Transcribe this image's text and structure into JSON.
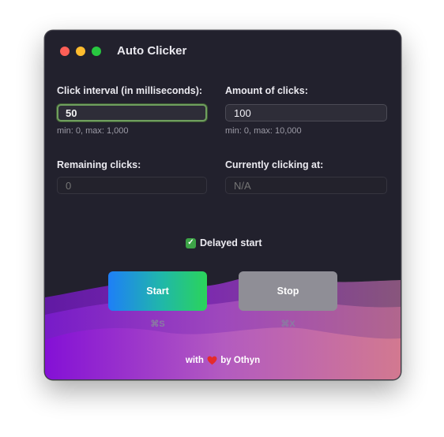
{
  "window": {
    "title": "Auto Clicker"
  },
  "interval": {
    "label": "Click interval (in milliseconds):",
    "value": "50",
    "hint": "min: 0, max: 1,000"
  },
  "amount": {
    "label": "Amount of clicks:",
    "value": "100",
    "hint": "min: 0, max: 10,000"
  },
  "remaining": {
    "label": "Remaining clicks:",
    "placeholder": "0"
  },
  "current": {
    "label": "Currently clicking at:",
    "placeholder": "N/A"
  },
  "delayed_start": {
    "label": "Delayed start",
    "checked": true
  },
  "buttons": {
    "start_label": "Start",
    "start_shortcut": "⌘S",
    "stop_label": "Stop",
    "stop_shortcut": "⌘X"
  },
  "footer": {
    "prefix": "with",
    "suffix": "by Othyn"
  },
  "colors": {
    "window_bg": "#22212d",
    "start_gradient": [
      "#1e7ff7",
      "#2bd45a"
    ],
    "stop_bg": "#8f8e96",
    "wave_purple": "#8a1fd0",
    "wave_pink": "#c87596",
    "checkbox": "#3da447"
  },
  "icons": {
    "checkbox": "checkmark-icon",
    "footer": "heart-icon"
  }
}
